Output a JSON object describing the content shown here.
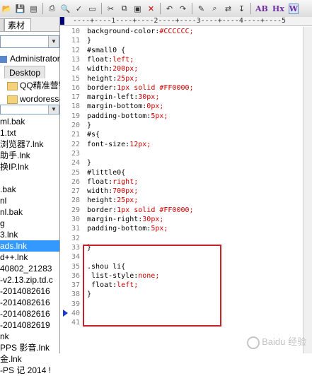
{
  "toolbar": {
    "buttons": [
      "open",
      "save",
      "save-all",
      "print",
      "print-preview",
      "spell-check",
      "document",
      "cut",
      "copy",
      "paste",
      "delete",
      "undo",
      "redo",
      "marker",
      "find",
      "replace",
      "goto"
    ],
    "text_buttons": [
      "AB",
      "Hx",
      "W"
    ]
  },
  "left_panel": {
    "tabs": [
      "",
      "素材"
    ],
    "tree": [
      {
        "label": "Administrator",
        "icon": "drive-icon"
      },
      {
        "label": "Desktop",
        "icon": "folder-icon"
      },
      {
        "label": "QQ精准营销",
        "icon": "folder-icon"
      },
      {
        "label": "wordoress-",
        "icon": "folder-icon"
      }
    ],
    "files": [
      "ml.bak",
      "1.txt",
      "浏览器7.lnk",
      "助手.lnk",
      "换IP.lnk",
      "",
      ".bak",
      "nl",
      "nl.bak",
      "g",
      "3.lnk",
      "ads.lnk",
      "d++.lnk",
      "40802_21283",
      "-v2.13.zip.td.c",
      "-2014082616",
      "-2014082616",
      "-2014082616",
      "-2014082619",
      "nk",
      "PPS 影音.lnk",
      "金.lnk",
      "-PS 记 2014 !"
    ],
    "selected_index": 11
  },
  "editor": {
    "ruler_text": "  ----+----1----+----2----+----3----+----4----+----5",
    "lines": [
      {
        "n": "10",
        "code": "background-color:#CCCCCC;"
      },
      {
        "n": "11",
        "code": "}"
      },
      {
        "n": "12",
        "code": "#small0 {"
      },
      {
        "n": "13",
        "code": "float:left;"
      },
      {
        "n": "14",
        "code": "width:200px;"
      },
      {
        "n": "15",
        "code": "height:25px;"
      },
      {
        "n": "16",
        "code": "border:1px solid #FF0000;"
      },
      {
        "n": "17",
        "code": "margin-left:30px;"
      },
      {
        "n": "18",
        "code": "margin-bottom:0px;"
      },
      {
        "n": "19",
        "code": "padding-bottom:5px;"
      },
      {
        "n": "20",
        "code": "}"
      },
      {
        "n": "21",
        "code": "#s{"
      },
      {
        "n": "22",
        "code": "font-size:12px;"
      },
      {
        "n": "23",
        "code": ""
      },
      {
        "n": "24",
        "code": "}"
      },
      {
        "n": "25",
        "code": "#little0{"
      },
      {
        "n": "26",
        "code": "float:right;"
      },
      {
        "n": "27",
        "code": "width:700px;"
      },
      {
        "n": "28",
        "code": "height:25px;"
      },
      {
        "n": "29",
        "code": "border:1px solid #FF0000;"
      },
      {
        "n": "30",
        "code": "margin-right:30px;"
      },
      {
        "n": "31",
        "code": "padding-bottom:5px;"
      },
      {
        "n": "32",
        "code": ""
      },
      {
        "n": "33",
        "code": "}"
      },
      {
        "n": "34",
        "code": ""
      },
      {
        "n": "35",
        "code": ".shou li{"
      },
      {
        "n": "36",
        "code": " list-style:none;"
      },
      {
        "n": "37",
        "code": " float:left;"
      },
      {
        "n": "38",
        "code": "}"
      },
      {
        "n": "39",
        "code": ""
      },
      {
        "n": "40",
        "code": ""
      },
      {
        "n": "41",
        "code": ""
      }
    ],
    "current_line": "40",
    "highlight_color": "#c8202a"
  },
  "watermark": "Baidu 经验"
}
